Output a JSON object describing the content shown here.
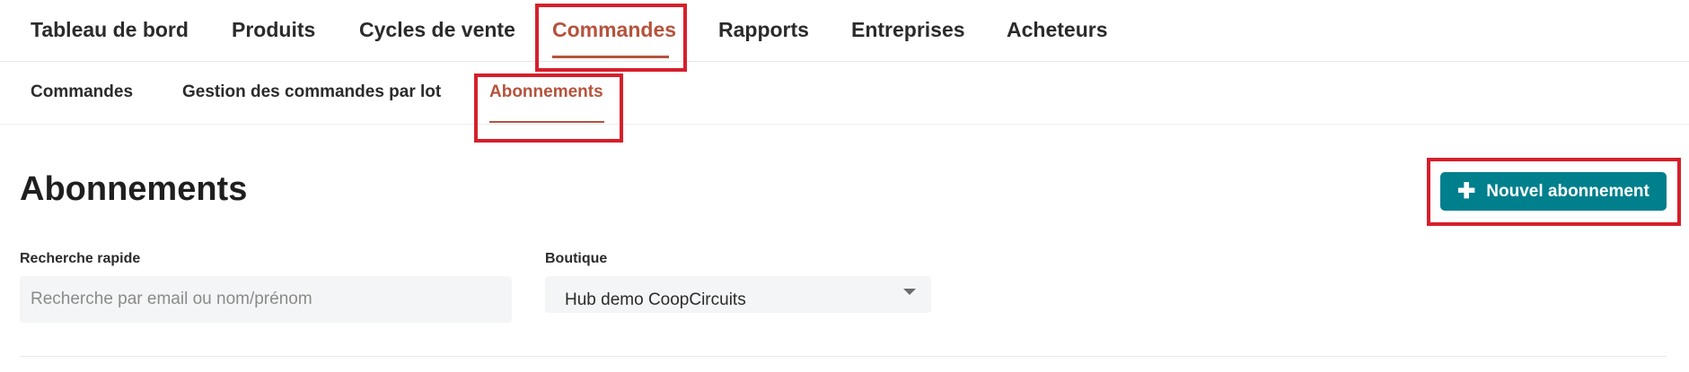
{
  "topnav": {
    "items": [
      {
        "label": "Tableau de bord"
      },
      {
        "label": "Produits"
      },
      {
        "label": "Cycles de vente"
      },
      {
        "label": "Commandes",
        "active": true
      },
      {
        "label": "Rapports"
      },
      {
        "label": "Entreprises"
      },
      {
        "label": "Acheteurs"
      }
    ]
  },
  "subnav": {
    "items": [
      {
        "label": "Commandes"
      },
      {
        "label": "Gestion des commandes par lot"
      },
      {
        "label": "Abonnements",
        "active": true
      }
    ]
  },
  "page": {
    "title": "Abonnements",
    "new_button_label": "Nouvel abonnement"
  },
  "filters": {
    "search": {
      "label": "Recherche rapide",
      "placeholder": "Recherche par email ou nom/prénom",
      "value": ""
    },
    "shop": {
      "label": "Boutique",
      "selected": "Hub demo CoopCircuits"
    }
  },
  "colors": {
    "accent": "#b5533c",
    "primary_button": "#007f8c",
    "highlight_box": "#d61f2c"
  },
  "icons": {
    "add": "plus-icon",
    "dropdown": "caret-down-icon"
  }
}
